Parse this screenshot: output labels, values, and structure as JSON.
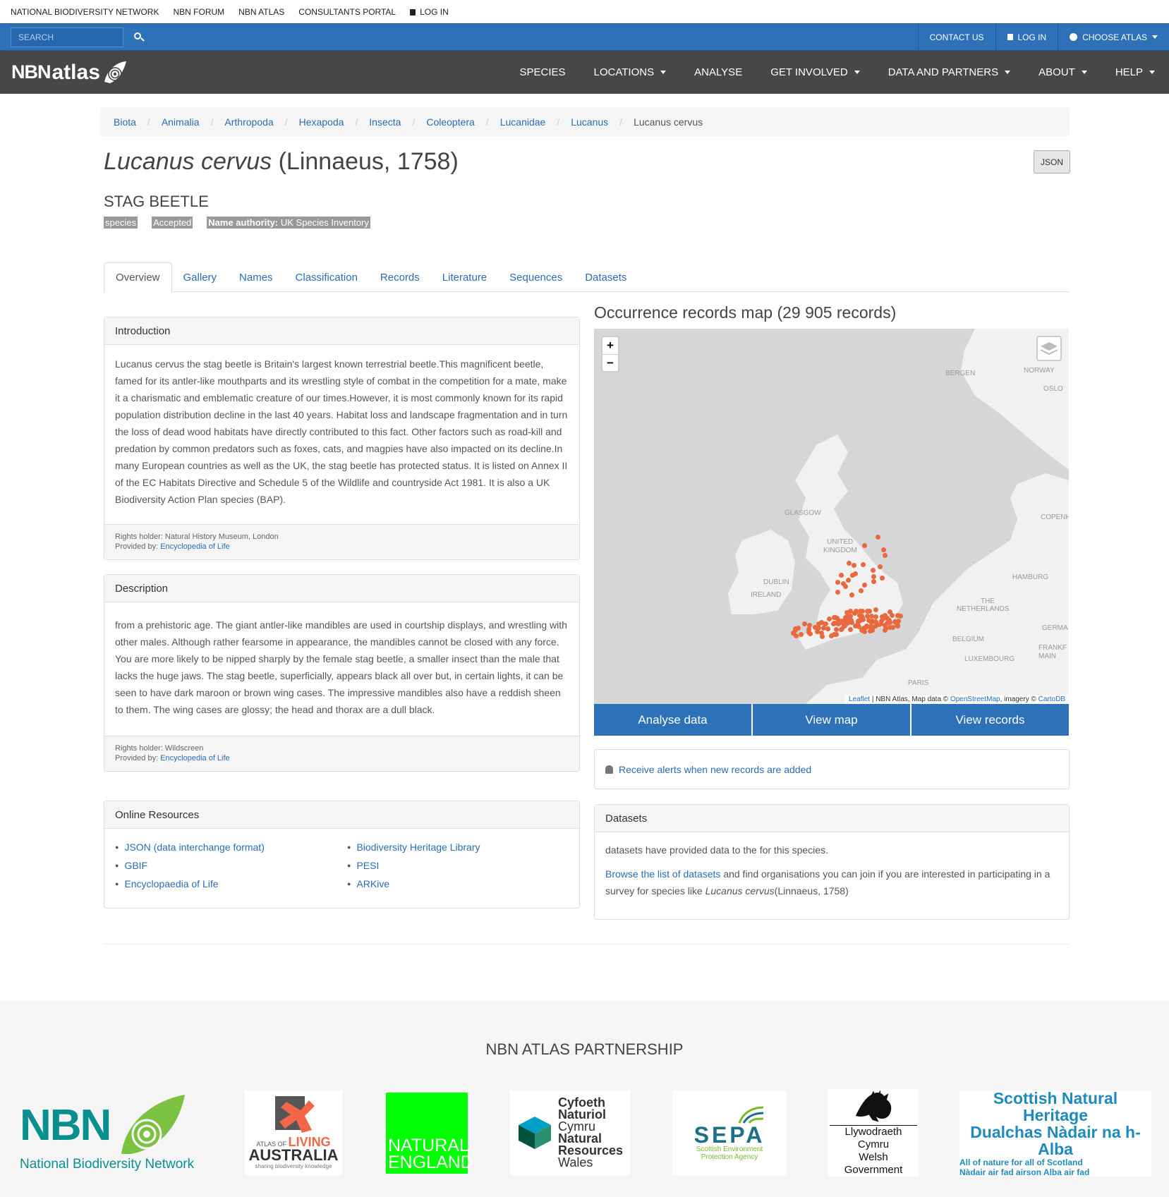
{
  "topbar": {
    "items": [
      "NATIONAL BIODIVERSITY NETWORK",
      "NBN FORUM",
      "NBN ATLAS",
      "CONSULTANTS PORTAL",
      "LOG IN"
    ]
  },
  "bluebar": {
    "search_placeholder": "SEARCH",
    "contact": "CONTACT US",
    "login": "LOG IN",
    "choose_atlas": "CHOOSE ATLAS"
  },
  "logo": {
    "nbn": "NBN",
    "atlas": "atlas"
  },
  "nav": [
    "SPECIES",
    "LOCATIONS",
    "ANALYSE",
    "GET INVOLVED",
    "DATA AND PARTNERS",
    "ABOUT",
    "HELP"
  ],
  "breadcrumb": [
    "Biota",
    "Animalia",
    "Arthropoda",
    "Hexapoda",
    "Insecta",
    "Coleoptera",
    "Lucanidae",
    "Lucanus",
    "Lucanus cervus"
  ],
  "species": {
    "name": "Lucanus cervus",
    "authority": "(Linnaeus, 1758)",
    "common": "STAG BEETLE",
    "rank": "species",
    "status": "Accepted",
    "name_authority_label": "Name authority:",
    "name_authority": "UK Species Inventory",
    "json_btn": "JSON"
  },
  "tabs": [
    "Overview",
    "Gallery",
    "Names",
    "Classification",
    "Records",
    "Literature",
    "Sequences",
    "Datasets"
  ],
  "introduction": {
    "heading": "Introduction",
    "text": "Lucanus cervus the stag beetle is Britain's largest known terrestrial beetle.This magnificent beetle, famed for its antler-like mouthparts and its wrestling style of combat in the competition for a mate, make it a charismatic and emblematic creature of our times.However, it is most commonly known for its rapid population distribution decline in the last 40 years. Habitat loss and landscape fragmentation and in turn the loss of dead wood habitats have directly contributed to this fact. Other factors such as road-kill and predation by common predators such as foxes, cats, and magpies have also impacted on its decline.In many European countries as well as the UK, the stag beetle has protected status. It is listed on Annex II of the EC Habitats Directive and Schedule 5 of the Wildlife and countryside Act 1981. It is also a UK Biodiversity Action Plan species (BAP).",
    "rights": "Rights holder: Natural History Museum, London",
    "provided_label": "Provided by:",
    "provided": "Encyclopedia of Life"
  },
  "description": {
    "heading": "Description",
    "text": "from a prehistoric age. The giant antler-like mandibles are used in courtship displays, and wrestling with other males. Although rather fearsome in appearance, the mandibles cannot be closed with any force. You are more likely to be nipped sharply by the female stag beetle, a smaller insect than the male that lacks the huge jaws. The stag beetle, superficially, appears black all over but, in certain lights, it can be seen to have dark maroon or brown wing cases. The impressive mandibles also have a reddish sheen to them. The wing cases are glossy; the head and thorax are a dull black.",
    "rights": "Rights holder: Wildscreen",
    "provided_label": "Provided by:",
    "provided": "Encyclopedia of Life"
  },
  "online_resources": {
    "heading": "Online Resources",
    "left": [
      "JSON (data interchange format)",
      "GBIF",
      "Encyclopaedia of Life"
    ],
    "right": [
      "Biodiversity Heritage Library",
      "PESI",
      "ARKive"
    ]
  },
  "map": {
    "title": "Occurrence records map (29 905 records)",
    "zoom_in": "+",
    "zoom_out": "−",
    "labels": [
      "BERGEN",
      "NORWAY",
      "OSLO",
      "GLASGOW",
      "UNITED",
      "KINGDOM",
      "COPENH",
      "DUBLIN",
      "IRELAND",
      "HAMBURG",
      "THE",
      "NETHERLANDS",
      "GERMA",
      "BELGIUM",
      "FRANKF",
      "MAIN",
      "LUXEMBOURG",
      "PARIS"
    ],
    "attr_leaflet": "Leaflet",
    "attr_mid": "| NBN Atlas, Map data ©",
    "attr_osm": "OpenStreetMap",
    "attr_imagery": ", imagery ©",
    "attr_carto": "CartoDB",
    "buttons": [
      "Analyse data",
      "View map",
      "View records"
    ]
  },
  "alerts": {
    "text": "Receive alerts when new records are added"
  },
  "datasets": {
    "heading": "Datasets",
    "line1": "datasets have provided data to the for this species.",
    "link": "Browse the list of datasets",
    "line2": "and find organisations you can join if you are interested in participating in a survey for species like",
    "species": "Lucanus cervus",
    "authority": "(Linnaeus, 1758)"
  },
  "footer": {
    "title": "NBN ATLAS PARTNERSHIP",
    "nbn_big": "NBN",
    "nbn_sub": "National Biodiversity Network",
    "ala_small": "ATLAS OF",
    "ala_living": "LIVING",
    "ala_aus": "AUSTRALIA",
    "ala_tag": "sharing biodiversity knowledge",
    "ne_1": "NATURAL",
    "ne_2": "ENGLAND",
    "nrw": [
      "Cyfoeth",
      "Naturiol",
      "Cymru",
      "Natural",
      "Resources",
      "Wales"
    ],
    "sepa": "SEPA",
    "sepa_sub1": "Scottish Environment",
    "sepa_sub2": "Protection Agency",
    "wg_1": "Llywodraeth Cymru",
    "wg_2": "Welsh Government",
    "snh_1": "Scottish Natural Heritage",
    "snh_2": "Dualchas Nàdair na h-Alba",
    "snh_3": "All of nature for all of Scotland",
    "snh_4": "Nàdair air fad airson Alba air fad"
  },
  "colors": {
    "primary": "#2d71b8",
    "dark": "#474747",
    "dots": "#e9683e"
  }
}
